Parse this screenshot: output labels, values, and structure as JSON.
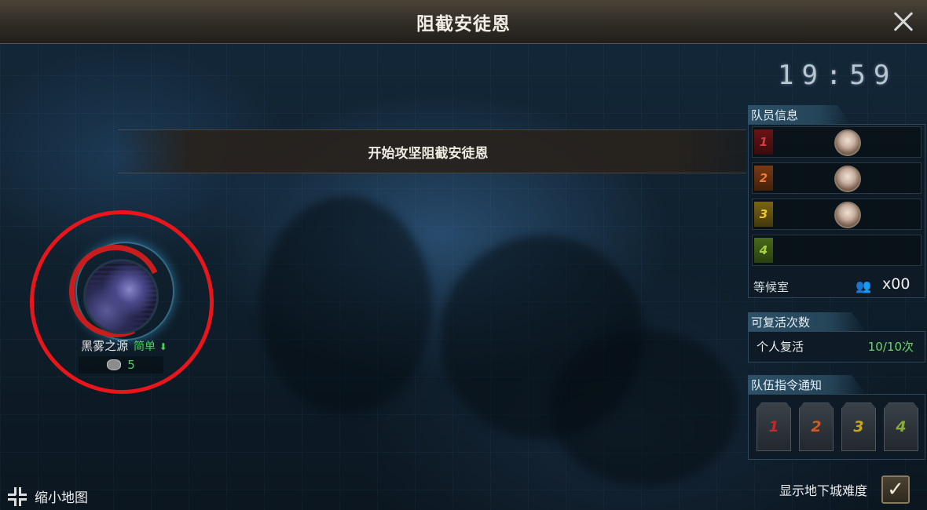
{
  "header": {
    "title": "阻截安徒恩"
  },
  "timer": {
    "display": "19:59"
  },
  "banner": {
    "message": "开始攻坚阻截安徒恩"
  },
  "dungeon": {
    "name": "黑雾之源",
    "difficulty": "简单",
    "cost_value": "5"
  },
  "team_info": {
    "tab_label": "队员信息",
    "members": [
      {
        "slot": "1",
        "color": "#b0282a",
        "occupied": true
      },
      {
        "slot": "2",
        "color": "#d26a1e",
        "occupied": true
      },
      {
        "slot": "3",
        "color": "#c9a41e",
        "occupied": true
      },
      {
        "slot": "4",
        "color": "#7aa02e",
        "occupied": false
      }
    ],
    "waiting_room_label": "等候室",
    "waiting_room_count": "x00"
  },
  "revive": {
    "tab_label": "可复活次数",
    "personal_label": "个人复活",
    "personal_value": "10/10次"
  },
  "team_commands": {
    "tab_label": "队伍指令通知",
    "buttons": [
      {
        "label": "1",
        "color": "#c0282a"
      },
      {
        "label": "2",
        "color": "#d25a1e"
      },
      {
        "label": "3",
        "color": "#c9a41e"
      },
      {
        "label": "4",
        "color": "#8aaa3a"
      }
    ]
  },
  "footer": {
    "shrink_map_label": "缩小地图",
    "show_difficulty_label": "显示地下城难度",
    "show_difficulty_checked": true
  }
}
